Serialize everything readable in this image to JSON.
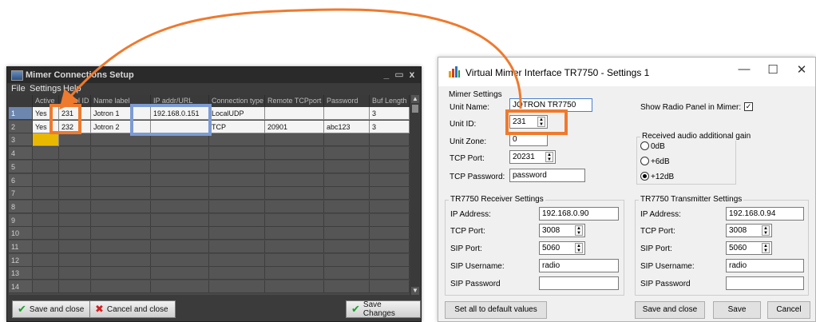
{
  "left_window": {
    "title": "Mimer Connections Setup",
    "menu": [
      "File",
      "Settings",
      "Help"
    ],
    "controls": {
      "minimize": "_",
      "maximize": "▭",
      "close": "x"
    },
    "columns": [
      "",
      "Active",
      "Panel ID",
      "Name label",
      "IP addr/URL",
      "Connection type",
      "Remote TCPport",
      "Password",
      "Buf Length"
    ],
    "rows": [
      {
        "num": "1",
        "cells": [
          "Yes",
          "231",
          "Jotron 1",
          "192.168.0.151",
          "LocalUDP",
          "",
          "",
          "3"
        ]
      },
      {
        "num": "2",
        "cells": [
          "Yes",
          "232",
          "Jotron 2",
          "",
          "TCP",
          "20901",
          "abc123",
          "3"
        ]
      },
      {
        "num": "3",
        "cells": [
          "",
          "",
          "",
          "",
          "",
          "",
          "",
          ""
        ]
      },
      {
        "num": "4",
        "cells": [
          "",
          "",
          "",
          "",
          "",
          "",
          "",
          ""
        ]
      },
      {
        "num": "5",
        "cells": [
          "",
          "",
          "",
          "",
          "",
          "",
          "",
          ""
        ]
      },
      {
        "num": "6",
        "cells": [
          "",
          "",
          "",
          "",
          "",
          "",
          "",
          ""
        ]
      },
      {
        "num": "7",
        "cells": [
          "",
          "",
          "",
          "",
          "",
          "",
          "",
          ""
        ]
      },
      {
        "num": "8",
        "cells": [
          "",
          "",
          "",
          "",
          "",
          "",
          "",
          ""
        ]
      },
      {
        "num": "9",
        "cells": [
          "",
          "",
          "",
          "",
          "",
          "",
          "",
          ""
        ]
      },
      {
        "num": "10",
        "cells": [
          "",
          "",
          "",
          "",
          "",
          "",
          "",
          ""
        ]
      },
      {
        "num": "11",
        "cells": [
          "",
          "",
          "",
          "",
          "",
          "",
          "",
          ""
        ]
      },
      {
        "num": "12",
        "cells": [
          "",
          "",
          "",
          "",
          "",
          "",
          "",
          ""
        ]
      },
      {
        "num": "13",
        "cells": [
          "",
          "",
          "",
          "",
          "",
          "",
          "",
          ""
        ]
      },
      {
        "num": "14",
        "cells": [
          "",
          "",
          "",
          "",
          "",
          "",
          "",
          ""
        ]
      }
    ],
    "buttons": {
      "save_close": "Save and close",
      "cancel_close": "Cancel and close",
      "save_changes": "Save Changes"
    }
  },
  "right_window": {
    "title": "Virtual Mimer Interface TR7750 - Settings 1",
    "controls": {
      "minimize": "—",
      "maximize": "☐",
      "close": "✕"
    },
    "mimer_settings": {
      "group_title": "Mimer Settings",
      "unit_name_label": "Unit Name:",
      "unit_name_value": "JOTRON TR7750",
      "unit_id_label": "Unit ID:",
      "unit_id_value": "231",
      "unit_zone_label": "Unit Zone:",
      "unit_zone_value": "0",
      "tcp_port_label": "TCP Port:",
      "tcp_port_value": "20231",
      "tcp_password_label": "TCP Password:",
      "tcp_password_value": "password",
      "show_radio_panel_label": "Show Radio Panel in Mimer:",
      "show_radio_panel_checked": true,
      "gain_group_title": "Received audio additional gain",
      "gain_options": [
        "0dB",
        "+6dB",
        "+12dB"
      ],
      "gain_selected": "+12dB"
    },
    "receiver": {
      "group_title": "TR7750 Receiver Settings",
      "ip_label": "IP Address:",
      "ip_value": "192.168.0.90",
      "tcp_label": "TCP Port:",
      "tcp_value": "3008",
      "sip_label": "SIP Port:",
      "sip_value": "5060",
      "user_label": "SIP Username:",
      "user_value": "radio",
      "pass_label": "SIP Password",
      "pass_value": ""
    },
    "transmitter": {
      "group_title": "TR7750 Transmitter Settings",
      "ip_label": "IP Address:",
      "ip_value": "192.168.0.94",
      "tcp_label": "TCP Port:",
      "tcp_value": "3008",
      "sip_label": "SIP Port:",
      "sip_value": "5060",
      "user_label": "SIP Username:",
      "user_value": "radio",
      "pass_label": "SIP Password",
      "pass_value": ""
    },
    "buttons": {
      "defaults": "Set all to default values",
      "save_close": "Save and close",
      "save": "Save",
      "cancel": "Cancel"
    }
  },
  "colors": {
    "highlight_orange": "#ee7a2e",
    "highlight_blue": "#7d9bd3",
    "selected_cell": "#e9b800"
  }
}
